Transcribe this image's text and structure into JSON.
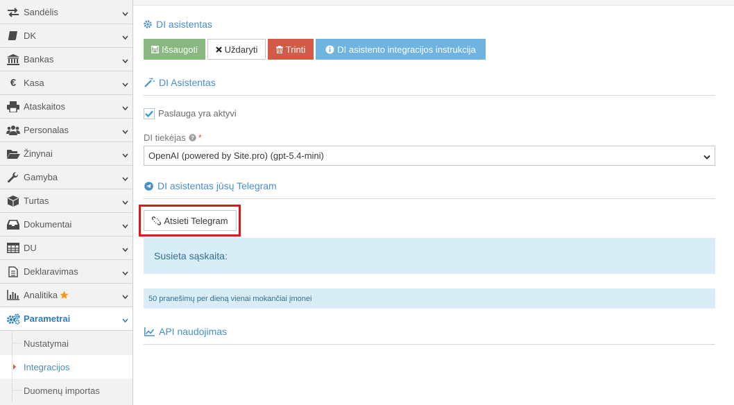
{
  "sidebar": {
    "items": [
      {
        "label": "Sandėlis",
        "icon": "exchange-icon"
      },
      {
        "label": "DK",
        "icon": "book-icon"
      },
      {
        "label": "Bankas",
        "icon": "bank-icon"
      },
      {
        "label": "Kasa",
        "icon": "euro-icon"
      },
      {
        "label": "Ataskaitos",
        "icon": "print-icon"
      },
      {
        "label": "Personalas",
        "icon": "users-icon"
      },
      {
        "label": "Žinynai",
        "icon": "folder-open-icon"
      },
      {
        "label": "Gamyba",
        "icon": "wrench-icon"
      },
      {
        "label": "Turtas",
        "icon": "cube-icon"
      },
      {
        "label": "Dokumentai",
        "icon": "inbox-icon"
      },
      {
        "label": "DU",
        "icon": "table-icon"
      },
      {
        "label": "Deklaravimas",
        "icon": "file-text-icon"
      },
      {
        "label": "Analitika",
        "icon": "bar-chart-icon"
      },
      {
        "label": "Parametrai",
        "icon": "cogs-icon"
      }
    ],
    "subitems": [
      {
        "label": "Nustatymai"
      },
      {
        "label": "Integracijos"
      },
      {
        "label": "Duomenų importas"
      }
    ]
  },
  "page": {
    "title": "DI asistentas",
    "toolbar": {
      "save_label": "Išsaugoti",
      "close_label": "Uždaryti",
      "delete_label": "Trinti",
      "info_label": "DI asistento integracijos instrukcija"
    },
    "section_assistant": "DI Asistentas",
    "service_active_label": "Paslauga yra aktyvi",
    "provider_label": "DI tiekėjas",
    "provider_required": "*",
    "provider_value": "OpenAI (powered by Site.pro) (gpt-5.4-mini)",
    "section_telegram": "DI asistentas jūsų Telegram",
    "unlink_telegram_label": "Atsieti Telegram",
    "linked_account_label": "Susieta sąskaita:",
    "limit_note": "50 pranešimų per dieną vienai mokančiai įmonei",
    "section_api": "API naudojimas"
  },
  "colors": {
    "accent": "#478fca",
    "save": "#87b87f",
    "delete": "#d15b47",
    "info": "#6fb3e0",
    "highlight": "#d9191c",
    "alert_bg": "#d9edf7",
    "star": "#f49a1f"
  }
}
